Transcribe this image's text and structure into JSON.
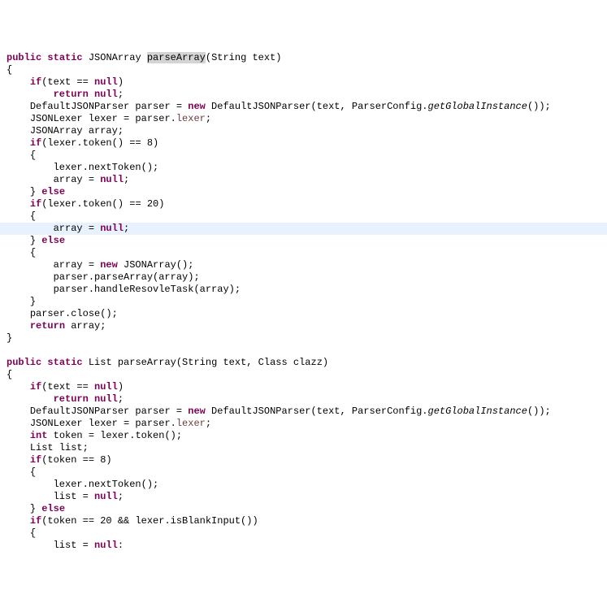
{
  "code": {
    "l1a": "public",
    "l1b": "static",
    "l1c": "JSONArray",
    "l1d": "parseArray",
    "l1e": "(String text)",
    "l2": "{",
    "l3a": "if",
    "l3b": "(text == ",
    "l3c": "null",
    "l3d": ")",
    "l4a": "return",
    "l4b": "null",
    "l4c": ";",
    "l5a": "DefaultJSONParser parser = ",
    "l5b": "new",
    "l5c": " DefaultJSONParser(text, ParserConfig.",
    "l5d": "getGlobalInstance",
    "l5e": "());",
    "l6a": "JSONLexer lexer = parser.",
    "l6b": "lexer",
    "l6c": ";",
    "l7": "JSONArray array;",
    "l8a": "if",
    "l8b": "(lexer.token() == 8)",
    "l9": "{",
    "l10": "lexer.nextToken();",
    "l11a": "array = ",
    "l11b": "null",
    "l11c": ";",
    "l12a": "} ",
    "l12b": "else",
    "l13a": "if",
    "l13b": "(lexer.token() == 20)",
    "l14": "{",
    "l15a": "array = ",
    "l15b": "null",
    "l15c": ";",
    "l16a": "} ",
    "l16b": "else",
    "l17": "{",
    "l18a": "array = ",
    "l18b": "new",
    "l18c": " JSONArray();",
    "l19": "parser.parseArray(array);",
    "l20": "parser.handleResovleTask(array);",
    "l21": "}",
    "l22": "parser.close();",
    "l23a": "return",
    "l23b": " array;",
    "l24": "}",
    "l26a": "public",
    "l26b": "static",
    "l26c": " List parseArray(String text, Class clazz)",
    "l27": "{",
    "l28a": "if",
    "l28b": "(text == ",
    "l28c": "null",
    "l28d": ")",
    "l29a": "return",
    "l29b": "null",
    "l29c": ";",
    "l30a": "DefaultJSONParser parser = ",
    "l30b": "new",
    "l30c": " DefaultJSONParser(text, ParserConfig.",
    "l30d": "getGlobalInstance",
    "l30e": "());",
    "l31a": "JSONLexer lexer = parser.",
    "l31b": "lexer",
    "l31c": ";",
    "l32a": "int",
    "l32b": " token = lexer.token();",
    "l33": "List list;",
    "l34a": "if",
    "l34b": "(token == 8)",
    "l35": "{",
    "l36": "lexer.nextToken();",
    "l37a": "list = ",
    "l37b": "null",
    "l37c": ";",
    "l38a": "} ",
    "l38b": "else",
    "l39a": "if",
    "l39b": "(token == 20 && lexer.isBlankInput())",
    "l40": "{",
    "l41a": "list = ",
    "l41b": "null",
    "l41c": ":"
  }
}
